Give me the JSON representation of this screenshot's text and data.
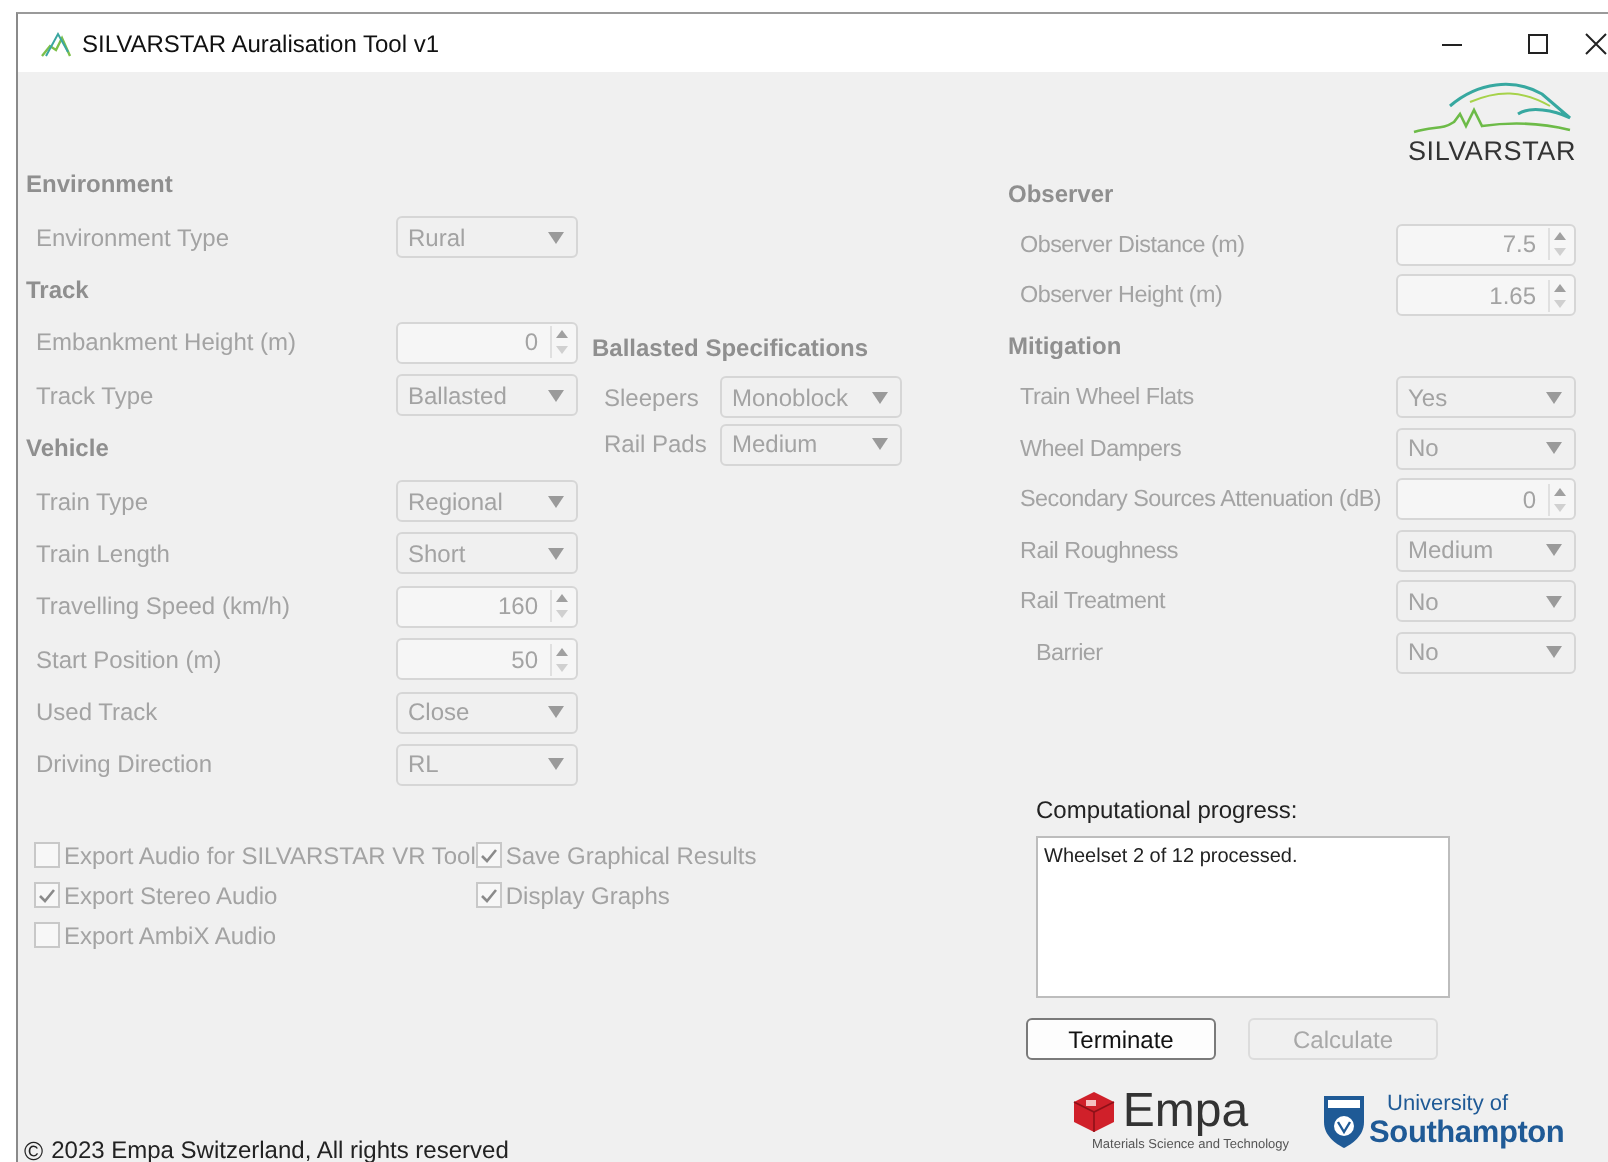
{
  "window": {
    "title": "SILVARSTAR Auralisation Tool v1"
  },
  "logo": {
    "text": "SILVARSTAR"
  },
  "environment": {
    "heading": "Environment",
    "fields": [
      {
        "label": "Environment Type",
        "kind": "dropdown",
        "value": "Rural",
        "disabled": true
      }
    ]
  },
  "track": {
    "heading": "Track",
    "fields": [
      {
        "label": "Embankment Height (m)",
        "kind": "spinner",
        "value": "0",
        "disabled": true
      },
      {
        "label": "Track Type",
        "kind": "dropdown",
        "value": "Ballasted",
        "disabled": true
      }
    ]
  },
  "vehicle": {
    "heading": "Vehicle",
    "fields": [
      {
        "label": "Train Type",
        "kind": "dropdown",
        "value": "Regional",
        "disabled": true
      },
      {
        "label": "Train Length",
        "kind": "dropdown",
        "value": "Short",
        "disabled": true
      },
      {
        "label": "Travelling Speed (km/h)",
        "kind": "spinner",
        "value": "160",
        "disabled": true
      },
      {
        "label": "Start Position (m)",
        "kind": "spinner",
        "value": "50",
        "disabled": true
      },
      {
        "label": "Used Track",
        "kind": "dropdown",
        "value": "Close",
        "disabled": true
      },
      {
        "label": "Driving Direction",
        "kind": "dropdown",
        "value": "RL",
        "disabled": true
      }
    ]
  },
  "ballasted_specifications": {
    "heading": "Ballasted Specifications",
    "fields": [
      {
        "label": "Sleepers",
        "kind": "dropdown",
        "value": "Monoblock",
        "disabled": true
      },
      {
        "label": "Rail Pads",
        "kind": "dropdown",
        "value": "Medium",
        "disabled": true
      }
    ]
  },
  "observer": {
    "heading": "Observer",
    "fields": [
      {
        "label": "Observer Distance (m)",
        "kind": "spinner",
        "value": "7.5",
        "disabled": true
      },
      {
        "label": "Observer Height (m)",
        "kind": "spinner",
        "value": "1.65",
        "disabled": true
      }
    ]
  },
  "mitigation": {
    "heading": "Mitigation",
    "fields": [
      {
        "label": "Train Wheel Flats",
        "kind": "dropdown",
        "value": "Yes",
        "disabled": true
      },
      {
        "label": "Wheel Dampers",
        "kind": "dropdown",
        "value": "No",
        "disabled": true
      },
      {
        "label": "Secondary Sources Attenuation (dB)",
        "kind": "spinner",
        "value": "0",
        "disabled": true
      },
      {
        "label": "Rail Roughness",
        "kind": "dropdown",
        "value": "Medium",
        "disabled": true
      },
      {
        "label": "Rail Treatment",
        "kind": "dropdown",
        "value": "No",
        "disabled": true,
        "children": [
          {
            "label": "Barrier",
            "kind": "dropdown",
            "value": "No",
            "disabled": true
          }
        ]
      }
    ]
  },
  "options": {
    "column_1": [
      {
        "label": "Export Audio for SILVARSTAR VR Tool",
        "checked": false,
        "disabled": true
      },
      {
        "label": "Export Stereo Audio",
        "checked": true,
        "disabled": true
      },
      {
        "label": "Export AmbiX Audio",
        "checked": false,
        "disabled": true
      }
    ],
    "column_2": [
      {
        "label": "Save Graphical Results",
        "checked": true,
        "disabled": true
      },
      {
        "label": "Display Graphs",
        "checked": true,
        "disabled": true
      }
    ]
  },
  "progress": {
    "label": "Computational progress:",
    "log": "Wheelset 2 of 12 processed."
  },
  "buttons": [
    {
      "label": "Terminate",
      "disabled": false
    },
    {
      "label": "Calculate",
      "disabled": true
    }
  ],
  "empa_logo": {
    "text": "Empa",
    "tagline": "Materials Science and Technology"
  },
  "southampton_logo": {
    "line_1": "University of",
    "line_2": "Southampton"
  },
  "footer": {
    "symbol": "©",
    "text": "2023 Empa Switzerland, All rights reserved"
  }
}
